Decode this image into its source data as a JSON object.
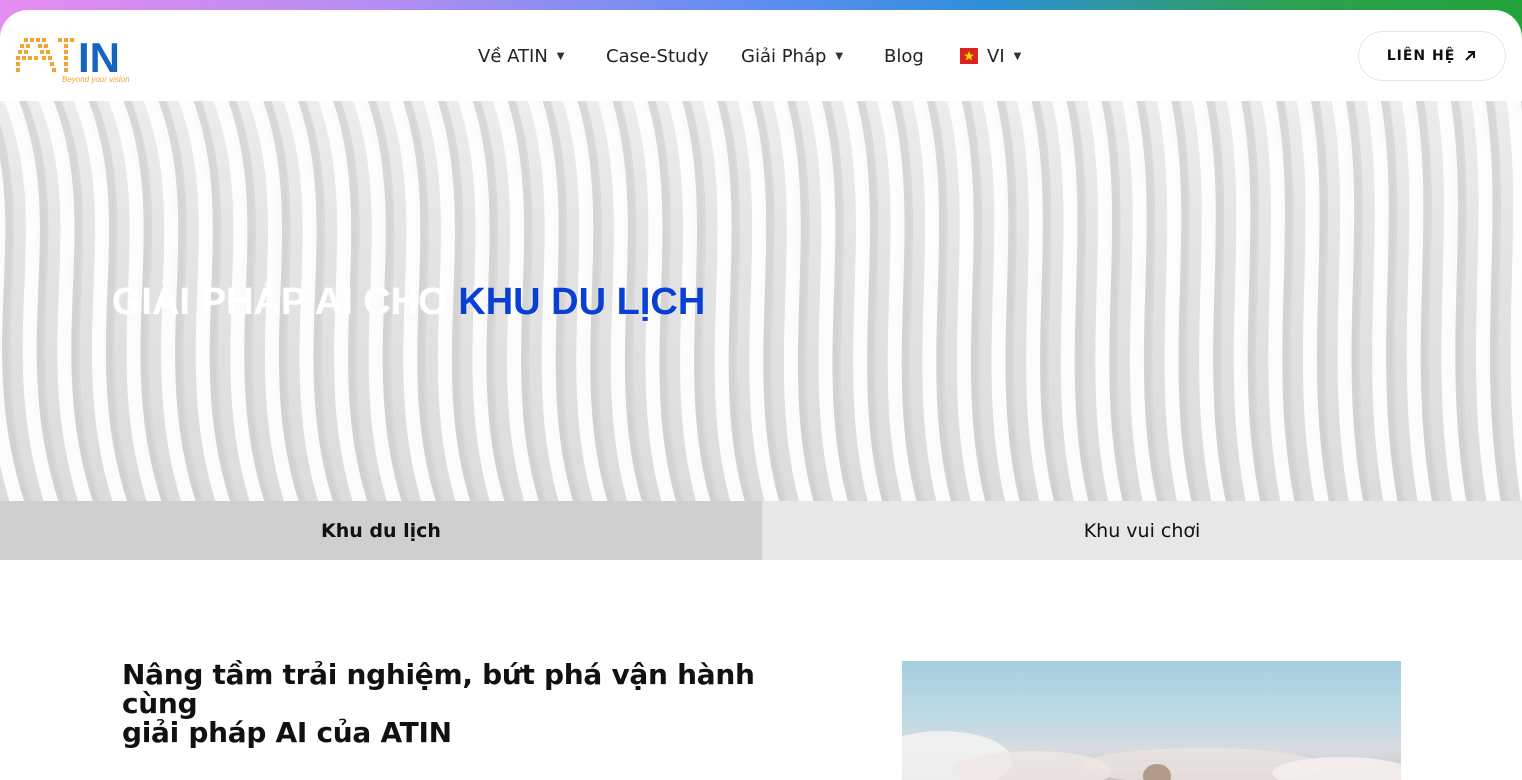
{
  "header": {
    "logo_text": "ATIN",
    "logo_tagline": "Beyond your vision",
    "nav": [
      {
        "label": "Về ATIN",
        "has_dropdown": true
      },
      {
        "label": "Case-Study",
        "has_dropdown": false
      },
      {
        "label": "Giải Pháp",
        "has_dropdown": true
      },
      {
        "label": "Blog",
        "has_dropdown": false
      },
      {
        "label": "VI",
        "has_dropdown": true,
        "icon": "vietnam-flag-icon"
      }
    ],
    "contact_label": "LIÊN HỆ"
  },
  "hero": {
    "title_prefix": "GIẢI PHÁP AI CHO ",
    "title_accent": "KHU DU LỊCH",
    "accent_color": "#0a3fd6"
  },
  "tabs": [
    {
      "label": "Khu du lịch",
      "active": true
    },
    {
      "label": "Khu vui chơi",
      "active": false
    }
  ],
  "section": {
    "heading_line1": "Nâng tầm trải nghiệm, bứt phá vận hành cùng",
    "heading_line2": "giải pháp AI của ATIN"
  }
}
